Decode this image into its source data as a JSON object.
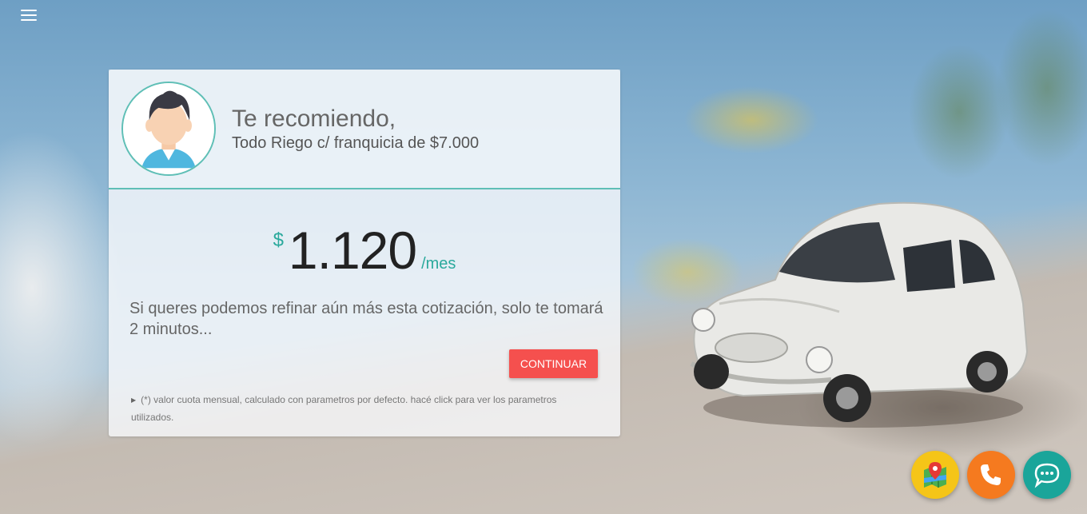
{
  "menu": {
    "icon": "hamburger-menu-icon"
  },
  "card": {
    "greeting": "Te recomiendo,",
    "plan": "Todo Riego c/ franquicia de $7.000",
    "price": {
      "currency": "$",
      "amount": "1.120",
      "unit": "/mes"
    },
    "pitch": "Si queres podemos refinar aún más esta cotización, solo te tomará 2 minutos...",
    "continue_label": "CONTINUAR",
    "footnote": "(*) valor cuota mensual, calculado con parametros por defecto. hacé click para ver los parametros utilizados."
  },
  "fabs": [
    {
      "icon": "map-pin-icon",
      "color": "#f5c518"
    },
    {
      "icon": "phone-icon",
      "color": "#f57a1f"
    },
    {
      "icon": "chat-bubble-icon",
      "color": "#1aa59a"
    }
  ],
  "colors": {
    "accent": "#2aa99c",
    "button": "#f5504e"
  }
}
